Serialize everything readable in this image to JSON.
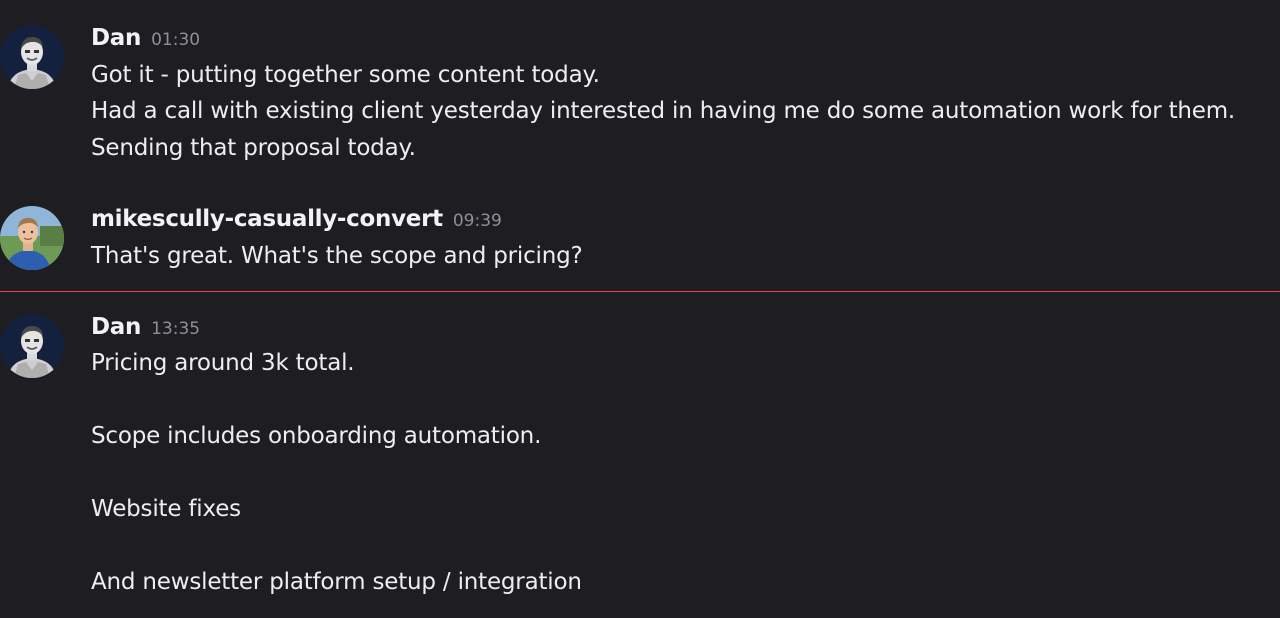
{
  "messages": [
    {
      "author": "Dan",
      "time": "01:30",
      "lines": [
        "Got it - putting together some content today.",
        "Had a call with existing client yesterday interested in having me do some automation work for them.",
        "Sending that proposal today."
      ]
    },
    {
      "author": "mikescully-casually-convert",
      "time": "09:39",
      "lines": [
        "That's great. What's the scope and pricing?"
      ]
    },
    {
      "author": "Dan",
      "time": "13:35",
      "lines": [
        "Pricing around 3k total.",
        "Scope includes onboarding automation.",
        "Website fixes",
        "And newsletter platform setup / integration"
      ]
    }
  ],
  "colors": {
    "background": "#1e1e22",
    "new_messages_divider": "#e0463e",
    "timestamp": "#8e9097"
  }
}
